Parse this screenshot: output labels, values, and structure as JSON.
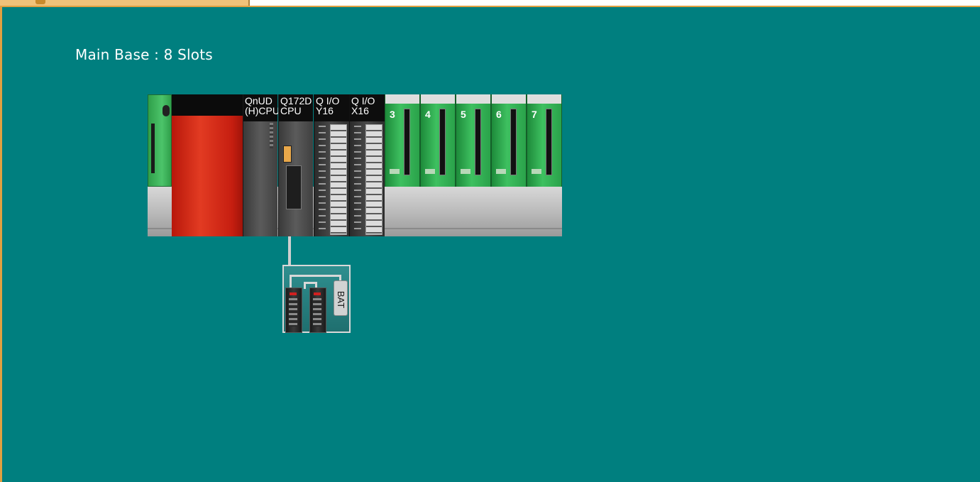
{
  "title": "Main Base : 8 Slots",
  "slots": {
    "cpu1_label": "QnUD\n(H)CPU",
    "cpu2_label": "Q172D\nCPU",
    "io1_label": "Q I/O\nY16",
    "io2_label": "Q I/O\nX16",
    "empty": [
      "3",
      "4",
      "5",
      "6",
      "7"
    ]
  },
  "battery_label": "BAT",
  "colors": {
    "background": "#007f7f",
    "power_supply": "#d32a17",
    "empty_slot": "#35b556"
  }
}
